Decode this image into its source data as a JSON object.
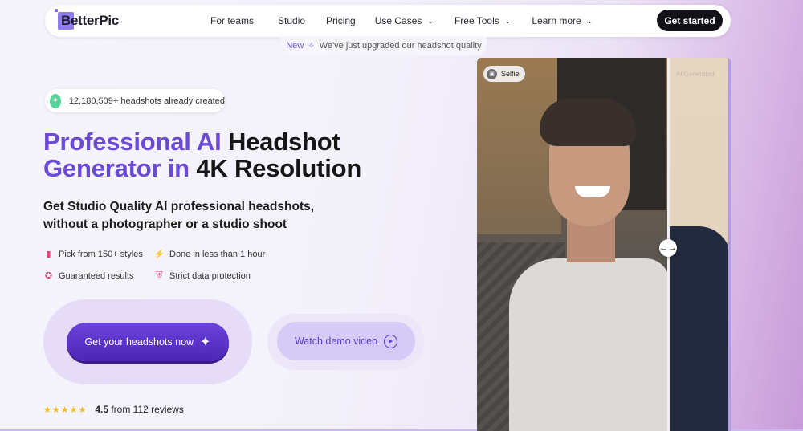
{
  "brand": {
    "name": "BetterPic"
  },
  "nav": {
    "items": [
      {
        "label": "For teams",
        "dropdown": false
      },
      {
        "label": "Studio",
        "dropdown": false
      },
      {
        "label": "Pricing",
        "dropdown": false
      },
      {
        "label": "Use Cases",
        "dropdown": true
      },
      {
        "label": "Free Tools",
        "dropdown": true
      },
      {
        "label": "Learn more",
        "dropdown": true
      }
    ],
    "cta": "Get started"
  },
  "announcement": {
    "badge": "New",
    "text": "We've just upgraded our headshot quality"
  },
  "hero": {
    "counter": "12,180,509+ headshots already created",
    "headline_purple": "Professional AI",
    "headline_dark_1": "Headshot",
    "headline_purple_2": "Generator in",
    "headline_dark_2": "4K Resolution",
    "subhead_line1": "Get Studio Quality AI professional headshots,",
    "subhead_line2": "without a photographer or a studio shoot",
    "features": [
      {
        "label": "Pick from 150+ styles",
        "icon": "styles-icon"
      },
      {
        "label": "Done in less than 1 hour",
        "icon": "lightning-icon"
      },
      {
        "label": "Guaranteed results",
        "icon": "badge-icon"
      },
      {
        "label": "Strict data protection",
        "icon": "shield-icon"
      }
    ],
    "primary_button": "Get your headshots now",
    "secondary_button": "Watch demo video",
    "rating": {
      "stars": 4.5,
      "score": "4.5",
      "text": "from 112 reviews"
    }
  },
  "comparison": {
    "left_label": "Selfie",
    "right_label": "AI Generated",
    "colors": {
      "accent": "#6a4ad6",
      "cta": "#111118",
      "star": "#f3b72a"
    }
  }
}
